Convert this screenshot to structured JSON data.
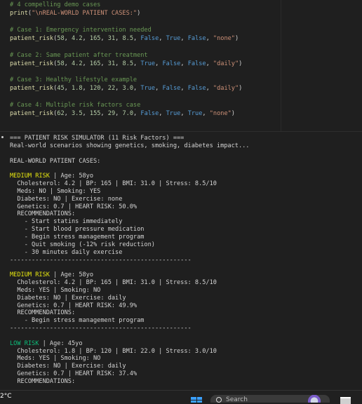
{
  "code": {
    "lines": [
      [
        {
          "t": "# 4 compelling demo cases",
          "c": "c-comment"
        }
      ],
      [
        {
          "t": "print",
          "c": "c-func"
        },
        {
          "t": "(",
          "c": "c-plain"
        },
        {
          "t": "\"\\nREAL-WORLD PATIENT CASES:\"",
          "c": "c-str"
        },
        {
          "t": ")",
          "c": "c-plain"
        }
      ],
      [],
      [
        {
          "t": "# Case 1: Emergency intervention needed",
          "c": "c-comment"
        }
      ],
      [
        {
          "t": "patient_risk",
          "c": "c-func"
        },
        {
          "t": "(",
          "c": "c-plain"
        },
        {
          "t": "58",
          "c": "c-num"
        },
        {
          "t": ", ",
          "c": "c-plain"
        },
        {
          "t": "4.2",
          "c": "c-num"
        },
        {
          "t": ", ",
          "c": "c-plain"
        },
        {
          "t": "165",
          "c": "c-num"
        },
        {
          "t": ", ",
          "c": "c-plain"
        },
        {
          "t": "31",
          "c": "c-num"
        },
        {
          "t": ", ",
          "c": "c-plain"
        },
        {
          "t": "8.5",
          "c": "c-num"
        },
        {
          "t": ", ",
          "c": "c-plain"
        },
        {
          "t": "False",
          "c": "c-kw"
        },
        {
          "t": ", ",
          "c": "c-plain"
        },
        {
          "t": "True",
          "c": "c-kw"
        },
        {
          "t": ", ",
          "c": "c-plain"
        },
        {
          "t": "False",
          "c": "c-kw"
        },
        {
          "t": ", ",
          "c": "c-plain"
        },
        {
          "t": "\"none\"",
          "c": "c-str"
        },
        {
          "t": ")",
          "c": "c-plain"
        }
      ],
      [],
      [
        {
          "t": "# Case 2: Same patient after treatment",
          "c": "c-comment"
        }
      ],
      [
        {
          "t": "patient_risk",
          "c": "c-func"
        },
        {
          "t": "(",
          "c": "c-plain"
        },
        {
          "t": "58",
          "c": "c-num"
        },
        {
          "t": ", ",
          "c": "c-plain"
        },
        {
          "t": "4.2",
          "c": "c-num"
        },
        {
          "t": ", ",
          "c": "c-plain"
        },
        {
          "t": "165",
          "c": "c-num"
        },
        {
          "t": ", ",
          "c": "c-plain"
        },
        {
          "t": "31",
          "c": "c-num"
        },
        {
          "t": ", ",
          "c": "c-plain"
        },
        {
          "t": "8.5",
          "c": "c-num"
        },
        {
          "t": ", ",
          "c": "c-plain"
        },
        {
          "t": "True",
          "c": "c-kw"
        },
        {
          "t": ", ",
          "c": "c-plain"
        },
        {
          "t": "False",
          "c": "c-kw"
        },
        {
          "t": ", ",
          "c": "c-plain"
        },
        {
          "t": "False",
          "c": "c-kw"
        },
        {
          "t": ", ",
          "c": "c-plain"
        },
        {
          "t": "\"daily\"",
          "c": "c-str"
        },
        {
          "t": ")",
          "c": "c-plain"
        }
      ],
      [],
      [
        {
          "t": "# Case 3: Healthy lifestyle example",
          "c": "c-comment"
        }
      ],
      [
        {
          "t": "patient_risk",
          "c": "c-func"
        },
        {
          "t": "(",
          "c": "c-plain"
        },
        {
          "t": "45",
          "c": "c-num"
        },
        {
          "t": ", ",
          "c": "c-plain"
        },
        {
          "t": "1.8",
          "c": "c-num"
        },
        {
          "t": ", ",
          "c": "c-plain"
        },
        {
          "t": "120",
          "c": "c-num"
        },
        {
          "t": ", ",
          "c": "c-plain"
        },
        {
          "t": "22",
          "c": "c-num"
        },
        {
          "t": ", ",
          "c": "c-plain"
        },
        {
          "t": "3.0",
          "c": "c-num"
        },
        {
          "t": ", ",
          "c": "c-plain"
        },
        {
          "t": "True",
          "c": "c-kw"
        },
        {
          "t": ", ",
          "c": "c-plain"
        },
        {
          "t": "False",
          "c": "c-kw"
        },
        {
          "t": ", ",
          "c": "c-plain"
        },
        {
          "t": "False",
          "c": "c-kw"
        },
        {
          "t": ", ",
          "c": "c-plain"
        },
        {
          "t": "\"daily\"",
          "c": "c-str"
        },
        {
          "t": ")",
          "c": "c-plain"
        }
      ],
      [],
      [
        {
          "t": "# Case 4: Multiple risk factors case",
          "c": "c-comment"
        }
      ],
      [
        {
          "t": "patient_risk",
          "c": "c-func"
        },
        {
          "t": "(",
          "c": "c-plain"
        },
        {
          "t": "62",
          "c": "c-num"
        },
        {
          "t": ", ",
          "c": "c-plain"
        },
        {
          "t": "3.5",
          "c": "c-num"
        },
        {
          "t": ", ",
          "c": "c-plain"
        },
        {
          "t": "155",
          "c": "c-num"
        },
        {
          "t": ", ",
          "c": "c-plain"
        },
        {
          "t": "29",
          "c": "c-num"
        },
        {
          "t": ", ",
          "c": "c-plain"
        },
        {
          "t": "7.0",
          "c": "c-num"
        },
        {
          "t": ", ",
          "c": "c-plain"
        },
        {
          "t": "False",
          "c": "c-kw"
        },
        {
          "t": ", ",
          "c": "c-plain"
        },
        {
          "t": "True",
          "c": "c-kw"
        },
        {
          "t": ", ",
          "c": "c-plain"
        },
        {
          "t": "True",
          "c": "c-kw"
        },
        {
          "t": ", ",
          "c": "c-plain"
        },
        {
          "t": "\"none\"",
          "c": "c-str"
        },
        {
          "t": ")",
          "c": "c-plain"
        }
      ]
    ]
  },
  "output": {
    "lines": [
      {
        "text": "=== PATIENT RISK SIMULATOR (11 Risk Factors) ==="
      },
      {
        "text": "Real-world scenarios showing genetics, smoking, diabetes impact..."
      },
      {
        "text": ""
      },
      {
        "text": "REAL-WORLD PATIENT CASES:"
      },
      {
        "text": ""
      },
      {
        "label": "MEDIUM RISK",
        "cls": "risk-medium",
        "text": " | Age: 58yo"
      },
      {
        "text": "  Cholesterol: 4.2 | BP: 165 | BMI: 31.0 | Stress: 8.5/10"
      },
      {
        "text": "  Meds: NO | Smoking: YES"
      },
      {
        "text": "  Diabetes: NO | Exercise: none"
      },
      {
        "text": "  Genetics: 0.7 | HEART RISK: 50.0%"
      },
      {
        "text": "  RECOMMENDATIONS:"
      },
      {
        "text": "    - Start statins immediately"
      },
      {
        "text": "    - Start blood pressure medication"
      },
      {
        "text": "    - Begin stress management program"
      },
      {
        "text": "    - Quit smoking (-12% risk reduction)"
      },
      {
        "text": "    - 30 minutes daily exercise"
      },
      {
        "text": "--------------------------------------------------"
      },
      {
        "text": ""
      },
      {
        "label": "MEDIUM RISK",
        "cls": "risk-medium",
        "text": " | Age: 58yo"
      },
      {
        "text": "  Cholesterol: 4.2 | BP: 165 | BMI: 31.0 | Stress: 8.5/10"
      },
      {
        "text": "  Meds: YES | Smoking: NO"
      },
      {
        "text": "  Diabetes: NO | Exercise: daily"
      },
      {
        "text": "  Genetics: 0.7 | HEART RISK: 49.9%"
      },
      {
        "text": "  RECOMMENDATIONS:"
      },
      {
        "text": "    - Begin stress management program"
      },
      {
        "text": "--------------------------------------------------"
      },
      {
        "text": ""
      },
      {
        "label": "LOW RISK",
        "cls": "risk-low",
        "text": " | Age: 45yo"
      },
      {
        "text": "  Cholesterol: 1.8 | BP: 120 | BMI: 22.0 | Stress: 3.0/10"
      },
      {
        "text": "  Meds: YES | Smoking: NO"
      },
      {
        "text": "  Diabetes: NO | Exercise: daily"
      },
      {
        "text": "  Genetics: 0.7 | HEART RISK: 37.4%"
      },
      {
        "text": "  RECOMMENDATIONS:"
      }
    ]
  },
  "taskbar": {
    "temperature": "2°C",
    "search_placeholder": "Search",
    "accent": "#3aa0ff"
  }
}
